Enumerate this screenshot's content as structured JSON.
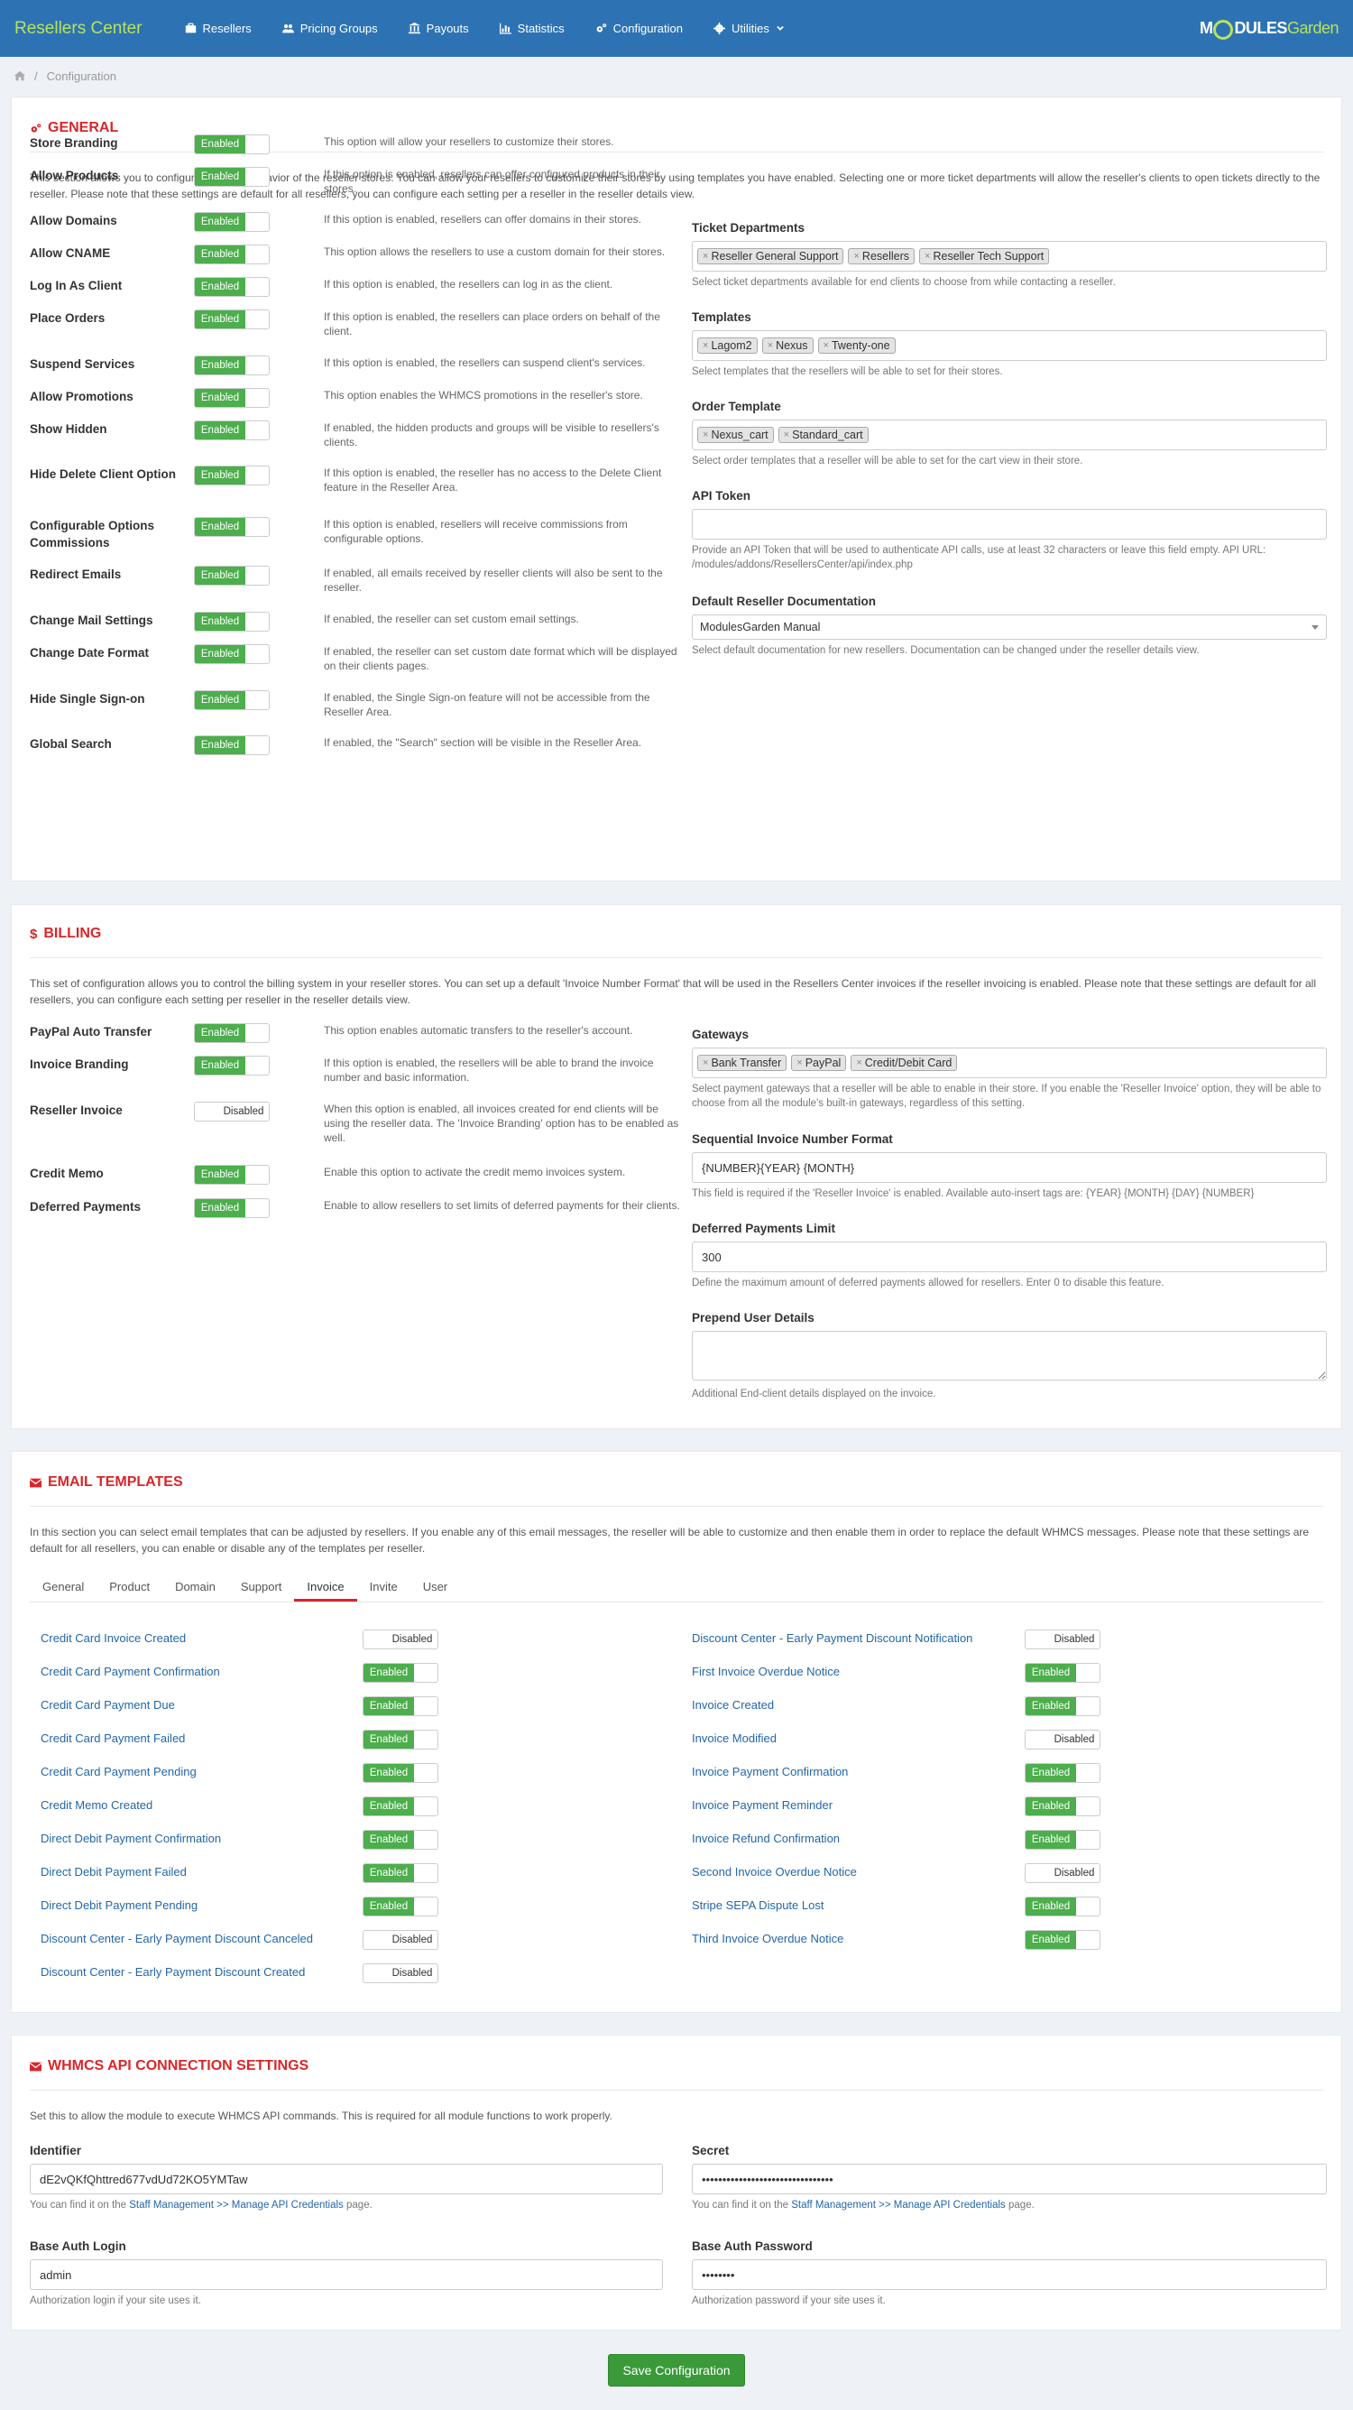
{
  "app": {
    "title": "Resellers Center",
    "logo_a": "M",
    "logo_b": "DULES",
    "logo_c": "Garden"
  },
  "nav": [
    {
      "label": "Resellers",
      "icon": "briefcase-icon"
    },
    {
      "label": "Pricing Groups",
      "icon": "users-icon"
    },
    {
      "label": "Payouts",
      "icon": "bank-icon"
    },
    {
      "label": "Statistics",
      "icon": "bar-chart-icon"
    },
    {
      "label": "Configuration",
      "icon": "cogs-icon"
    },
    {
      "label": "Utilities",
      "icon": "gear-icon"
    }
  ],
  "breadcrumb": {
    "current": "Configuration",
    "separator": "/"
  },
  "general": {
    "title": "GENERAL",
    "intro": "This section allows you to configure a default behavior of the reseller stores. You can allow your resellers to customize their stores by using templates you have enabled. Selecting one or more ticket departments will allow the reseller's clients to open tickets directly to the reseller. Please note that these settings are default for all resellers, you can configure each setting per a reseller in the reseller details view.",
    "options": [
      {
        "label": "Store Branding",
        "state": "Enabled",
        "desc": "This option will allow your resellers to customize their stores."
      },
      {
        "label": "Allow Products",
        "state": "Enabled",
        "desc": "If this option is enabled, resellers can offer configured products in their stores."
      },
      {
        "label": "Allow Domains",
        "state": "Enabled",
        "desc": "If this option is enabled, resellers can offer domains in their stores."
      },
      {
        "label": "Allow CNAME",
        "state": "Enabled",
        "desc": "This option allows the resellers to use a custom domain for their stores."
      },
      {
        "label": "Log In As Client",
        "state": "Enabled",
        "desc": "If this option is enabled, the resellers can log in as the client."
      },
      {
        "label": "Place Orders",
        "state": "Enabled",
        "desc": "If this option is enabled, the resellers can place orders on behalf of the client."
      },
      {
        "label": "Suspend Services",
        "state": "Enabled",
        "desc": "If this option is enabled, the resellers can suspend client's services."
      },
      {
        "label": "Allow Promotions",
        "state": "Enabled",
        "desc": "This option enables the WHMCS promotions in the reseller's store."
      },
      {
        "label": "Show Hidden",
        "state": "Enabled",
        "desc": "If enabled, the hidden products and groups will be visible to resellers's clients."
      },
      {
        "label": "Hide Delete Client Option",
        "state": "Enabled",
        "desc": "If this option is enabled, the reseller has no access to the Delete Client feature in the Reseller Area."
      },
      {
        "label": "Configurable Options Commissions",
        "state": "Enabled",
        "desc": "If this option is enabled, resellers will receive commissions from configurable options."
      },
      {
        "label": "Redirect Emails",
        "state": "Enabled",
        "desc": "If enabled, all emails received by reseller clients will also be sent to the reseller."
      },
      {
        "label": "Change Mail Settings",
        "state": "Enabled",
        "desc": "If enabled, the reseller can set custom email settings."
      },
      {
        "label": "Change Date Format",
        "state": "Enabled",
        "desc": "If enabled, the reseller can set custom date format which will be displayed on their clients pages."
      },
      {
        "label": "Hide Single Sign-on",
        "state": "Enabled",
        "desc": "If enabled, the Single Sign-on feature will not be accessible from the Reseller Area."
      },
      {
        "label": "Global Search",
        "state": "Enabled",
        "desc": "If enabled, the \"Search\" section will be visible in the Reseller Area."
      }
    ],
    "ticket_departments": {
      "title": "Ticket Departments",
      "tags": [
        "Reseller General Support",
        "Resellers",
        "Reseller Tech Support"
      ],
      "help": "Select ticket departments available for end clients to choose from while contacting a reseller."
    },
    "templates": {
      "title": "Templates",
      "tags": [
        "Lagom2",
        "Nexus",
        "Twenty-one"
      ],
      "help": "Select templates that the resellers will be able to set for their stores."
    },
    "order_template": {
      "title": "Order Template",
      "tags": [
        "Nexus_cart",
        "Standard_cart"
      ],
      "help": "Select order templates that a reseller will be able to set for the cart view in their store."
    },
    "api_token": {
      "title": "API Token",
      "value": "",
      "help": "Provide an API Token that will be used to authenticate API calls, use at least 32 characters or leave this field empty. API URL: /modules/addons/ResellersCenter/api/index.php"
    },
    "default_doc": {
      "title": "Default Reseller Documentation",
      "value": "ModulesGarden Manual",
      "help": "Select default documentation for new resellers. Documentation can be changed under the reseller details view."
    }
  },
  "billing": {
    "title": "BILLING",
    "intro": "This set of configuration allows you to control the billing system in your reseller stores. You can set up a default 'Invoice Number Format' that will be used in the Resellers Center invoices if the reseller invoicing is enabled. Please note that these settings are default for all resellers, you can configure each setting per reseller in the reseller details view.",
    "options": [
      {
        "label": "PayPal Auto Transfer",
        "state": "Enabled",
        "desc": "This option enables automatic transfers to the reseller's account."
      },
      {
        "label": "Invoice Branding",
        "state": "Enabled",
        "desc": "If this option is enabled, the resellers will be able to brand the invoice number and basic information."
      },
      {
        "label": "Reseller Invoice",
        "state": "Disabled",
        "desc": "When this option is enabled, all invoices created for end clients will be using the reseller data. The 'Invoice Branding' option has to be enabled as well."
      },
      {
        "label": "Credit Memo",
        "state": "Enabled",
        "desc": "Enable this option to activate the credit memo invoices system."
      },
      {
        "label": "Deferred Payments",
        "state": "Enabled",
        "desc": "Enable to allow resellers to set limits of deferred payments for their clients."
      }
    ],
    "gateways": {
      "title": "Gateways",
      "tags": [
        "Bank Transfer",
        "PayPal",
        "Credit/Debit Card"
      ],
      "help": "Select payment gateways that a reseller will be able to enable in their store. If you enable the 'Reseller Invoice' option, they will be able to choose from all the module's built-in gateways, regardless of this setting."
    },
    "seq_format": {
      "title": "Sequential Invoice Number Format",
      "value": "{NUMBER}{YEAR} {MONTH}",
      "help": "This field is required if the 'Reseller Invoice' is enabled. Available auto-insert tags are: {YEAR} {MONTH} {DAY} {NUMBER}"
    },
    "deferred_limit": {
      "title": "Deferred Payments Limit",
      "value": "300",
      "help": "Define the maximum amount of deferred payments allowed for resellers. Enter 0 to disable this feature."
    },
    "prepend": {
      "title": "Prepend User Details",
      "value": "",
      "help": "Additional End-client details displayed on the invoice."
    }
  },
  "email": {
    "title": "EMAIL TEMPLATES",
    "intro": "In this section you can select email templates that can be adjusted by resellers. If you enable any of this email messages, the reseller will be able to customize and then enable them in order to replace the default WHMCS messages. Please note that these settings are default for all resellers, you can enable or disable any of the templates per reseller.",
    "tabs": [
      "General",
      "Product",
      "Domain",
      "Support",
      "Invoice",
      "Invite",
      "User"
    ],
    "active_tab": "Invoice",
    "left": [
      {
        "label": "Credit Card Invoice Created",
        "state": "Disabled"
      },
      {
        "label": "Credit Card Payment Confirmation",
        "state": "Enabled"
      },
      {
        "label": "Credit Card Payment Due",
        "state": "Enabled"
      },
      {
        "label": "Credit Card Payment Failed",
        "state": "Enabled"
      },
      {
        "label": "Credit Card Payment Pending",
        "state": "Enabled"
      },
      {
        "label": "Credit Memo Created",
        "state": "Enabled"
      },
      {
        "label": "Direct Debit Payment Confirmation",
        "state": "Enabled"
      },
      {
        "label": "Direct Debit Payment Failed",
        "state": "Enabled"
      },
      {
        "label": "Direct Debit Payment Pending",
        "state": "Enabled"
      },
      {
        "label": "Discount Center - Early Payment Discount Canceled",
        "state": "Disabled"
      },
      {
        "label": "Discount Center - Early Payment Discount Created",
        "state": "Disabled"
      }
    ],
    "right": [
      {
        "label": "Discount Center - Early Payment Discount Notification",
        "state": "Disabled"
      },
      {
        "label": "First Invoice Overdue Notice",
        "state": "Enabled"
      },
      {
        "label": "Invoice Created",
        "state": "Enabled"
      },
      {
        "label": "Invoice Modified",
        "state": "Disabled"
      },
      {
        "label": "Invoice Payment Confirmation",
        "state": "Enabled"
      },
      {
        "label": "Invoice Payment Reminder",
        "state": "Enabled"
      },
      {
        "label": "Invoice Refund Confirmation",
        "state": "Enabled"
      },
      {
        "label": "Second Invoice Overdue Notice",
        "state": "Disabled"
      },
      {
        "label": "Stripe SEPA Dispute Lost",
        "state": "Enabled"
      },
      {
        "label": "Third Invoice Overdue Notice",
        "state": "Enabled"
      }
    ]
  },
  "api": {
    "title": "WHMCS API CONNECTION SETTINGS",
    "intro": "Set this to allow the module to execute WHMCS API commands. This is required for all module functions to work properly.",
    "identifier": {
      "title": "Identifier",
      "value": "dE2vQKfQhttred677vdUd72KO5YMTaw",
      "help_pre": "You can find it on the ",
      "help_link": "Staff Management >> Manage API Credentials",
      "help_post": " page."
    },
    "secret": {
      "title": "Secret",
      "value": "••••••••••••••••••••••••••••••••",
      "help_pre": "You can find it on the ",
      "help_link": "Staff Management >> Manage API Credentials",
      "help_post": " page."
    },
    "auth_login": {
      "title": "Base Auth Login",
      "value": "admin",
      "help": "Authorization login if your site uses it."
    },
    "auth_password": {
      "title": "Base Auth Password",
      "value": "••••••••",
      "help": "Authorization password if your site uses it."
    }
  },
  "save_label": "Save Configuration",
  "colors": {
    "accent": "#d9262a",
    "topbar": "#2d73b4",
    "enabled": "#4cae4c",
    "link": "#2366a8"
  }
}
